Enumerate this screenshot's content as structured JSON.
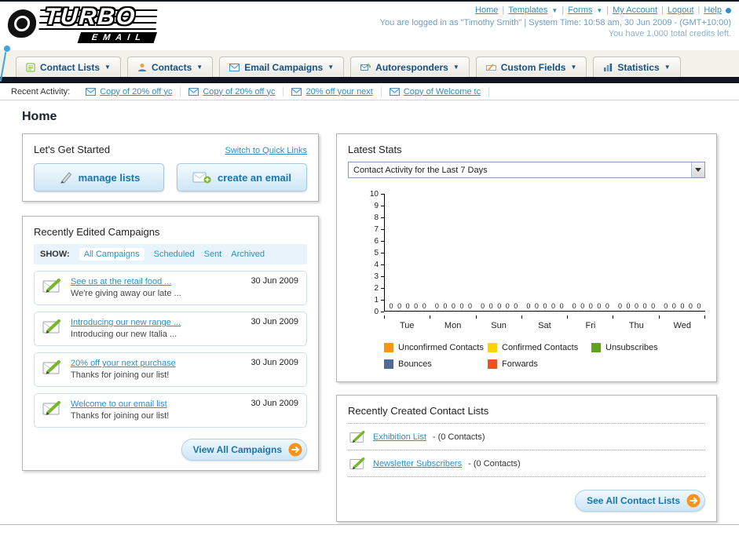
{
  "colors": {
    "accent_blue": "#2e8fc7",
    "dark_bar": "#101520",
    "orange": "#f7941d"
  },
  "header": {
    "logo": {
      "line1": "TURBO",
      "line2": "EMAIL"
    },
    "nav": {
      "items": [
        {
          "label": "Home"
        },
        {
          "label": "Templates"
        },
        {
          "label": "Forms"
        },
        {
          "label": "My Account"
        },
        {
          "label": "Logout"
        },
        {
          "label": "Help"
        }
      ]
    },
    "login_line": "You are logged in as \"Timothy Smith\" | System Time: 10:58 am, 30 Jun 2009 - (GMT+10:00)",
    "credits_line": "You have 1,000 total credits left."
  },
  "tabs": [
    {
      "label": "Contact Lists"
    },
    {
      "label": "Contacts"
    },
    {
      "label": "Email Campaigns"
    },
    {
      "label": "Autoresponders"
    },
    {
      "label": "Custom Fields"
    },
    {
      "label": "Statistics"
    }
  ],
  "recent_activity": {
    "label": "Recent Activity:",
    "items": [
      {
        "label": "Copy of 20% off yc"
      },
      {
        "label": "Copy of 20% off yc"
      },
      {
        "label": "20% off your next"
      },
      {
        "label": "Copy of Welcome tc"
      }
    ]
  },
  "page": {
    "title": "Home"
  },
  "get_started": {
    "title": "Let's Get Started",
    "switch_link": "Switch to Quick Links",
    "manage_lists_label": "manage lists",
    "create_email_label": "create an email"
  },
  "campaigns": {
    "title": "Recently Edited Campaigns",
    "show_label": "SHOW:",
    "filters": [
      {
        "label": "All Campaigns",
        "active": true
      },
      {
        "label": "Scheduled",
        "active": false
      },
      {
        "label": "Sent",
        "active": false
      },
      {
        "label": "Archived",
        "active": false
      }
    ],
    "items": [
      {
        "title": "See us at the retail food ...",
        "subtitle": "We're giving away our late ...",
        "date": "30 Jun 2009"
      },
      {
        "title": "Introducing our new range ...",
        "subtitle": "Introducing our new Italia ...",
        "date": "30 Jun 2009"
      },
      {
        "title": "20% off your next purchase",
        "subtitle": "Thanks for joining our list!",
        "date": "30 Jun 2009"
      },
      {
        "title": "Welcome to our email list",
        "subtitle": "Thanks for joining our list!",
        "date": "30 Jun 2009"
      }
    ],
    "view_all_label": "View All Campaigns"
  },
  "stats": {
    "title": "Latest Stats",
    "dropdown_value": "Contact Activity for the Last 7 Days",
    "chart_data": {
      "type": "bar",
      "categories": [
        "Tue",
        "Mon",
        "Sun",
        "Sat",
        "Fri",
        "Thu",
        "Wed"
      ],
      "series": [
        {
          "name": "Unconfirmed Contacts",
          "color": "#f7941d",
          "values": [
            0,
            0,
            0,
            0,
            0,
            0,
            0
          ]
        },
        {
          "name": "Confirmed Contacts",
          "color": "#ffd200",
          "values": [
            0,
            0,
            0,
            0,
            0,
            0,
            0
          ]
        },
        {
          "name": "Unsubscribes",
          "color": "#5fa321",
          "values": [
            0,
            0,
            0,
            0,
            0,
            0,
            0
          ]
        },
        {
          "name": "Bounces",
          "color": "#50699b",
          "values": [
            0,
            0,
            0,
            0,
            0,
            0,
            0
          ]
        },
        {
          "name": "Forwards",
          "color": "#e8531f",
          "values": [
            0,
            0,
            0,
            0,
            0,
            0,
            0
          ]
        }
      ],
      "ylim": [
        0,
        10
      ],
      "grid": false,
      "legend_position": "bottom"
    }
  },
  "contact_lists": {
    "title": "Recently Created Contact Lists",
    "items": [
      {
        "name": "Exhibition List",
        "suffix": "- (0 Contacts)"
      },
      {
        "name": "Newsletter Subscribers",
        "suffix": "- (0 Contacts)"
      }
    ],
    "see_all_label": "See All Contact Lists"
  }
}
